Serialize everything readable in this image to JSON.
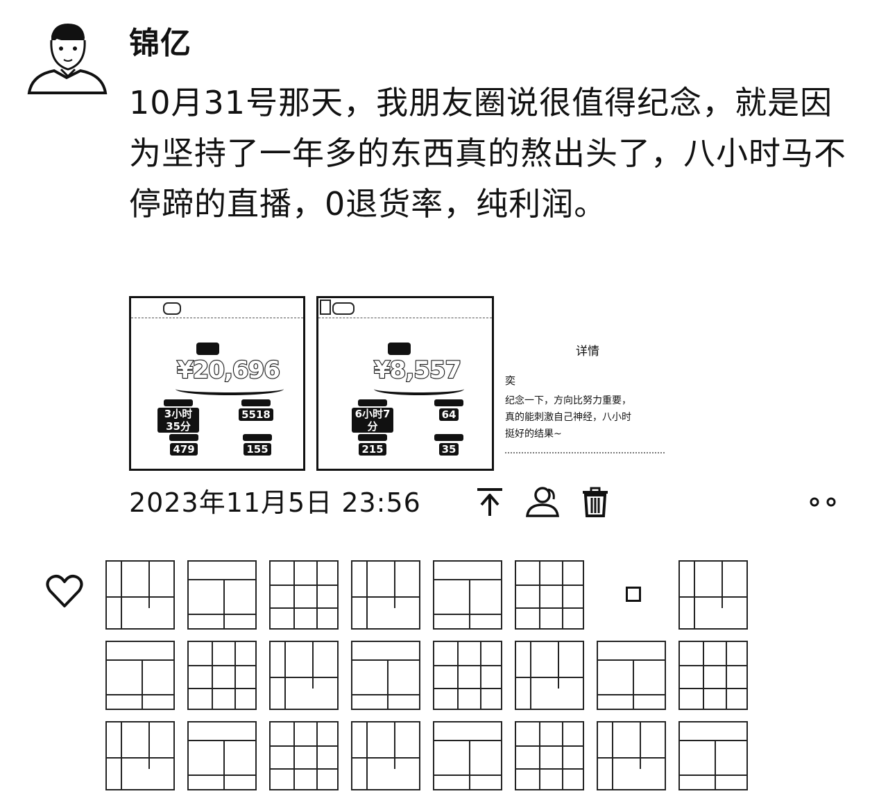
{
  "post": {
    "author": "锦亿",
    "text": "10月31号那天，我朋友圈说很值得纪念，就是因为坚持了一年多的东西真的熬出头了，八小时马不停蹄的直播，0退货率，纯利润。",
    "timestamp": "2023年11月5日 23:56"
  },
  "images": [
    {
      "amount": "¥20,696",
      "stats": [
        "3小时35分",
        "5518",
        "479",
        "155"
      ]
    },
    {
      "amount": "¥8,557",
      "stats": [
        "6小时7分",
        "64",
        "215",
        "35"
      ]
    }
  ],
  "detail": {
    "title": "详情",
    "name": "奕",
    "body": "纪念一下，方向比努力重要，\n真的能刺激自己神经，八小时\n挺好的结果~"
  },
  "icons": {
    "share": "share-icon",
    "visibility": "people-icon",
    "delete": "trash-icon",
    "more": "more-dots-icon",
    "like": "heart-icon"
  },
  "likes": {
    "rows": 3,
    "per_row": 8
  }
}
